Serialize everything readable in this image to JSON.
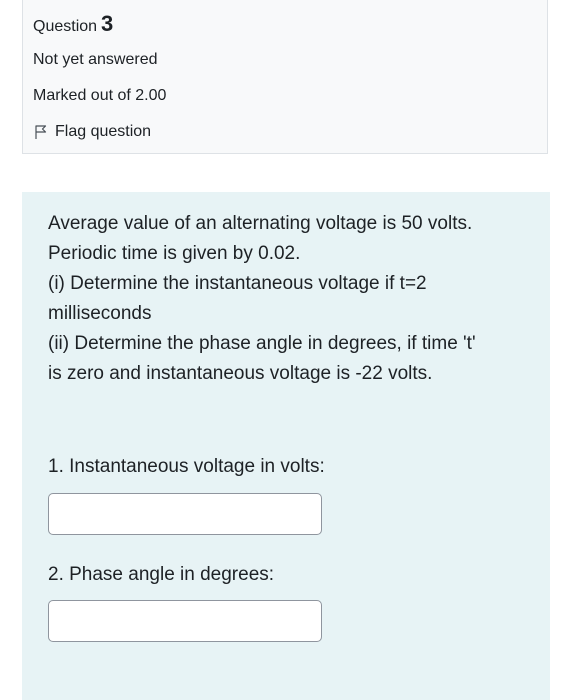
{
  "info": {
    "question_label": "Question",
    "question_number": "3",
    "state": "Not yet answered",
    "grade": "Marked out of 2.00",
    "flag_label": "Flag question",
    "flag_icon": "flag-outline-icon"
  },
  "question": {
    "text_lines": [
      "Average value of an alternating voltage is 50 volts.",
      "Periodic time is given by 0.02.",
      "(i) Determine the instantaneous voltage if t=2",
      "milliseconds",
      "(ii) Determine the phase angle in degrees, if time 't'",
      "is zero and instantaneous voltage is -22 volts."
    ],
    "parts": [
      {
        "label": "1. Instantaneous voltage in volts:",
        "value": ""
      },
      {
        "label": "2. Phase angle in degrees:",
        "value": ""
      }
    ]
  },
  "colors": {
    "info_background": "#f8f9fa",
    "formulation_background": "#e7f3f5",
    "text": "#1d2125"
  }
}
